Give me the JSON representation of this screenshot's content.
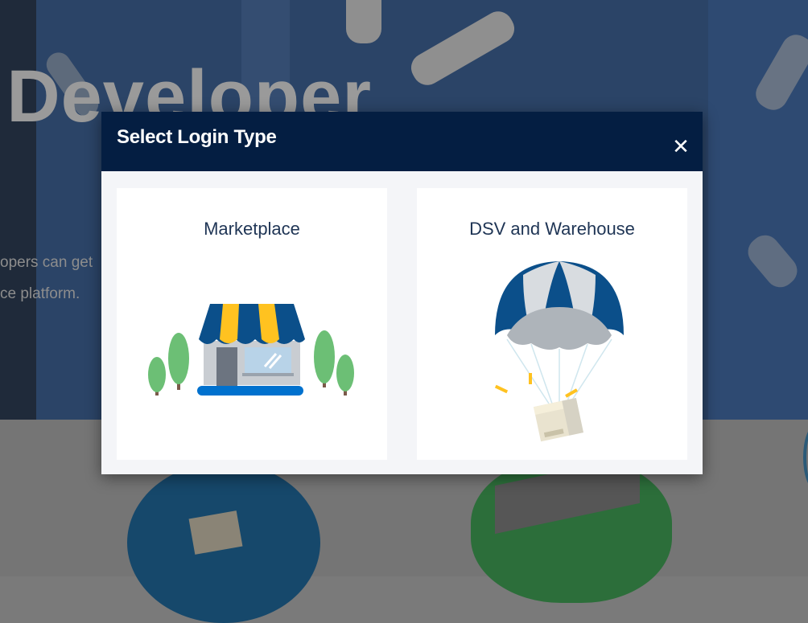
{
  "background": {
    "hero_title": "t Developer",
    "hero_lines": [
      "opers can get",
      "ce platform."
    ]
  },
  "modal": {
    "title": "Select Login Type",
    "close_glyph": "✕",
    "options": [
      {
        "label": "Marketplace",
        "icon": "storefront-icon"
      },
      {
        "label": "DSV and Warehouse",
        "icon": "parachute-package-icon"
      }
    ]
  },
  "colors": {
    "header_bg": "#041e42",
    "brand_blue": "#0b4f8a",
    "spark_yellow": "#ffc220",
    "card_bg": "#ffffff",
    "modal_bg": "#f4f5f8"
  }
}
